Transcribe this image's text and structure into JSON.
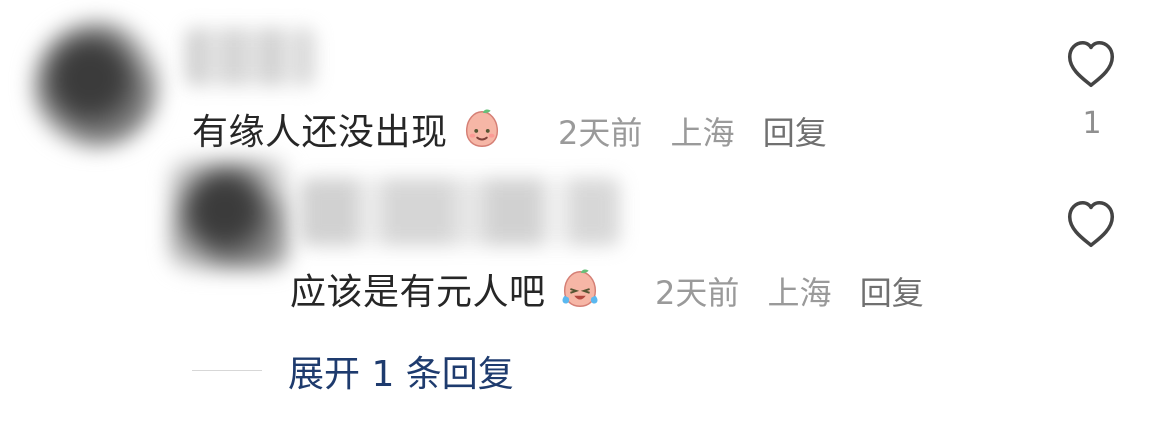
{
  "comments": [
    {
      "text": "有缘人还没出现",
      "emoji": "smiling-peach-emoji",
      "time": "2天前",
      "location": "上海",
      "reply_label": "回复",
      "like_count": "1"
    }
  ],
  "replies": [
    {
      "text": "应该是有元人吧",
      "emoji": "crying-laughing-peach-emoji",
      "time": "2天前",
      "location": "上海",
      "reply_label": "回复"
    }
  ],
  "expand_label": "展开 1 条回复",
  "icons": {
    "like": "heart-outline-icon"
  }
}
